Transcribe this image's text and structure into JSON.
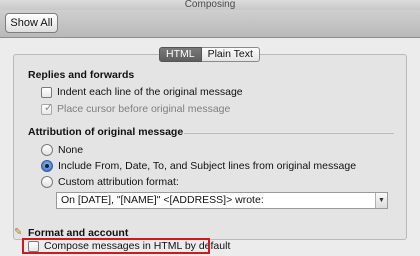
{
  "window": {
    "title": "Composing"
  },
  "toolbar": {
    "show_all_label": "Show All"
  },
  "tabs": [
    {
      "label": "HTML",
      "selected": true
    },
    {
      "label": "Plain Text",
      "selected": false
    }
  ],
  "replies": {
    "title": "Replies and forwards",
    "indent_label": "Indent each line of the original message",
    "indent_checked": false,
    "cursor_label": "Place cursor before original message",
    "cursor_checked": true,
    "cursor_disabled": true
  },
  "attribution": {
    "title": "Attribution of original message",
    "options": [
      {
        "label": "None",
        "selected": false
      },
      {
        "label": "Include From, Date, To, and Subject lines from original message",
        "selected": true
      },
      {
        "label": "Custom attribution format:",
        "selected": false
      }
    ],
    "custom_format_value": "On [DATE], \"[NAME]\" <[ADDRESS]> wrote:"
  },
  "format": {
    "title": "Format and account",
    "compose_html_label": "Compose messages in HTML by default",
    "compose_html_checked": false
  },
  "colors": {
    "highlight": "#d4171c",
    "radio_selected": "#2f6bc2"
  },
  "icons": {
    "checkmark": "checkmark-icon",
    "popup": "chevron-down-icon",
    "format": "pencil-icon"
  }
}
